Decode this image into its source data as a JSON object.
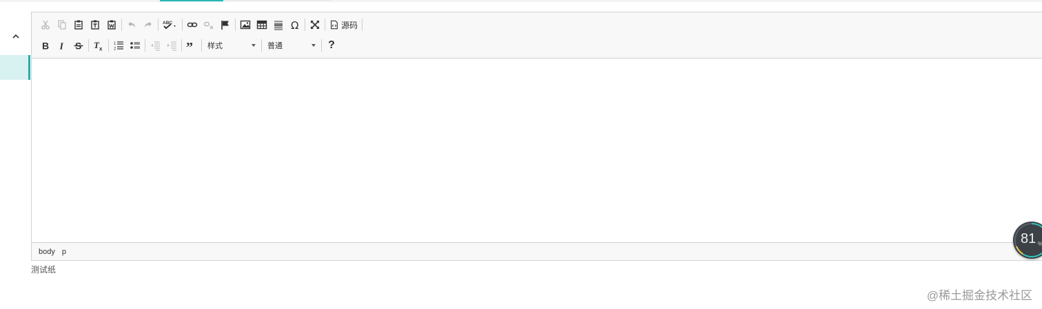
{
  "editor": {
    "style_combo": "样式",
    "format_combo": "普通",
    "source_label": "源码",
    "help_label": "?",
    "statusbar": [
      "body",
      "p"
    ]
  },
  "below_text": "测试纸",
  "gauge": {
    "value": "81",
    "unit": "%"
  },
  "watermark": "@稀土掘金技术社区",
  "colors": {
    "accent": "#2aabab",
    "rail_active_bg": "#d8f1f1"
  }
}
